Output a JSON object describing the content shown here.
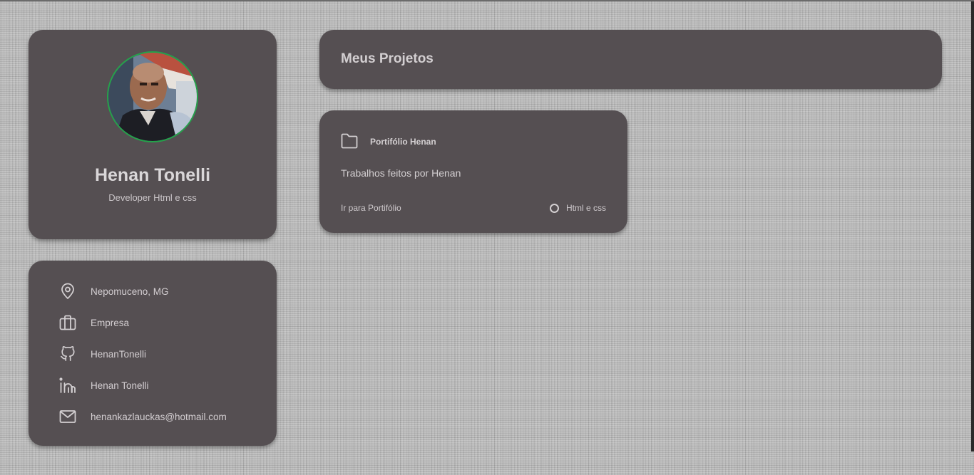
{
  "profile": {
    "name": "Henan Tonelli",
    "role": "Developer Html e css",
    "avatar_icon": "profile-photo"
  },
  "info": {
    "items": [
      {
        "icon": "map-pin-icon",
        "label": "Nepomuceno, MG"
      },
      {
        "icon": "briefcase-icon",
        "label": "Empresa"
      },
      {
        "icon": "github-icon",
        "label": "HenanTonelli"
      },
      {
        "icon": "linkedin-icon",
        "label": "Henan Tonelli"
      },
      {
        "icon": "mail-icon",
        "label": "henankazlauckas@hotmail.com"
      }
    ]
  },
  "projects_header": {
    "title": "Meus Projetos"
  },
  "projects": [
    {
      "icon": "folder-icon",
      "name": "Portifólio Henan",
      "description": "Trabalhos feitos por Henan",
      "link_label": "Ir para Portifólio",
      "language": "Html e css"
    }
  ],
  "colors": {
    "card_bg": "#554f52",
    "text": "#d3cfd1",
    "avatar_ring": "#24a34a",
    "page_bg": "#bdbdbd"
  }
}
